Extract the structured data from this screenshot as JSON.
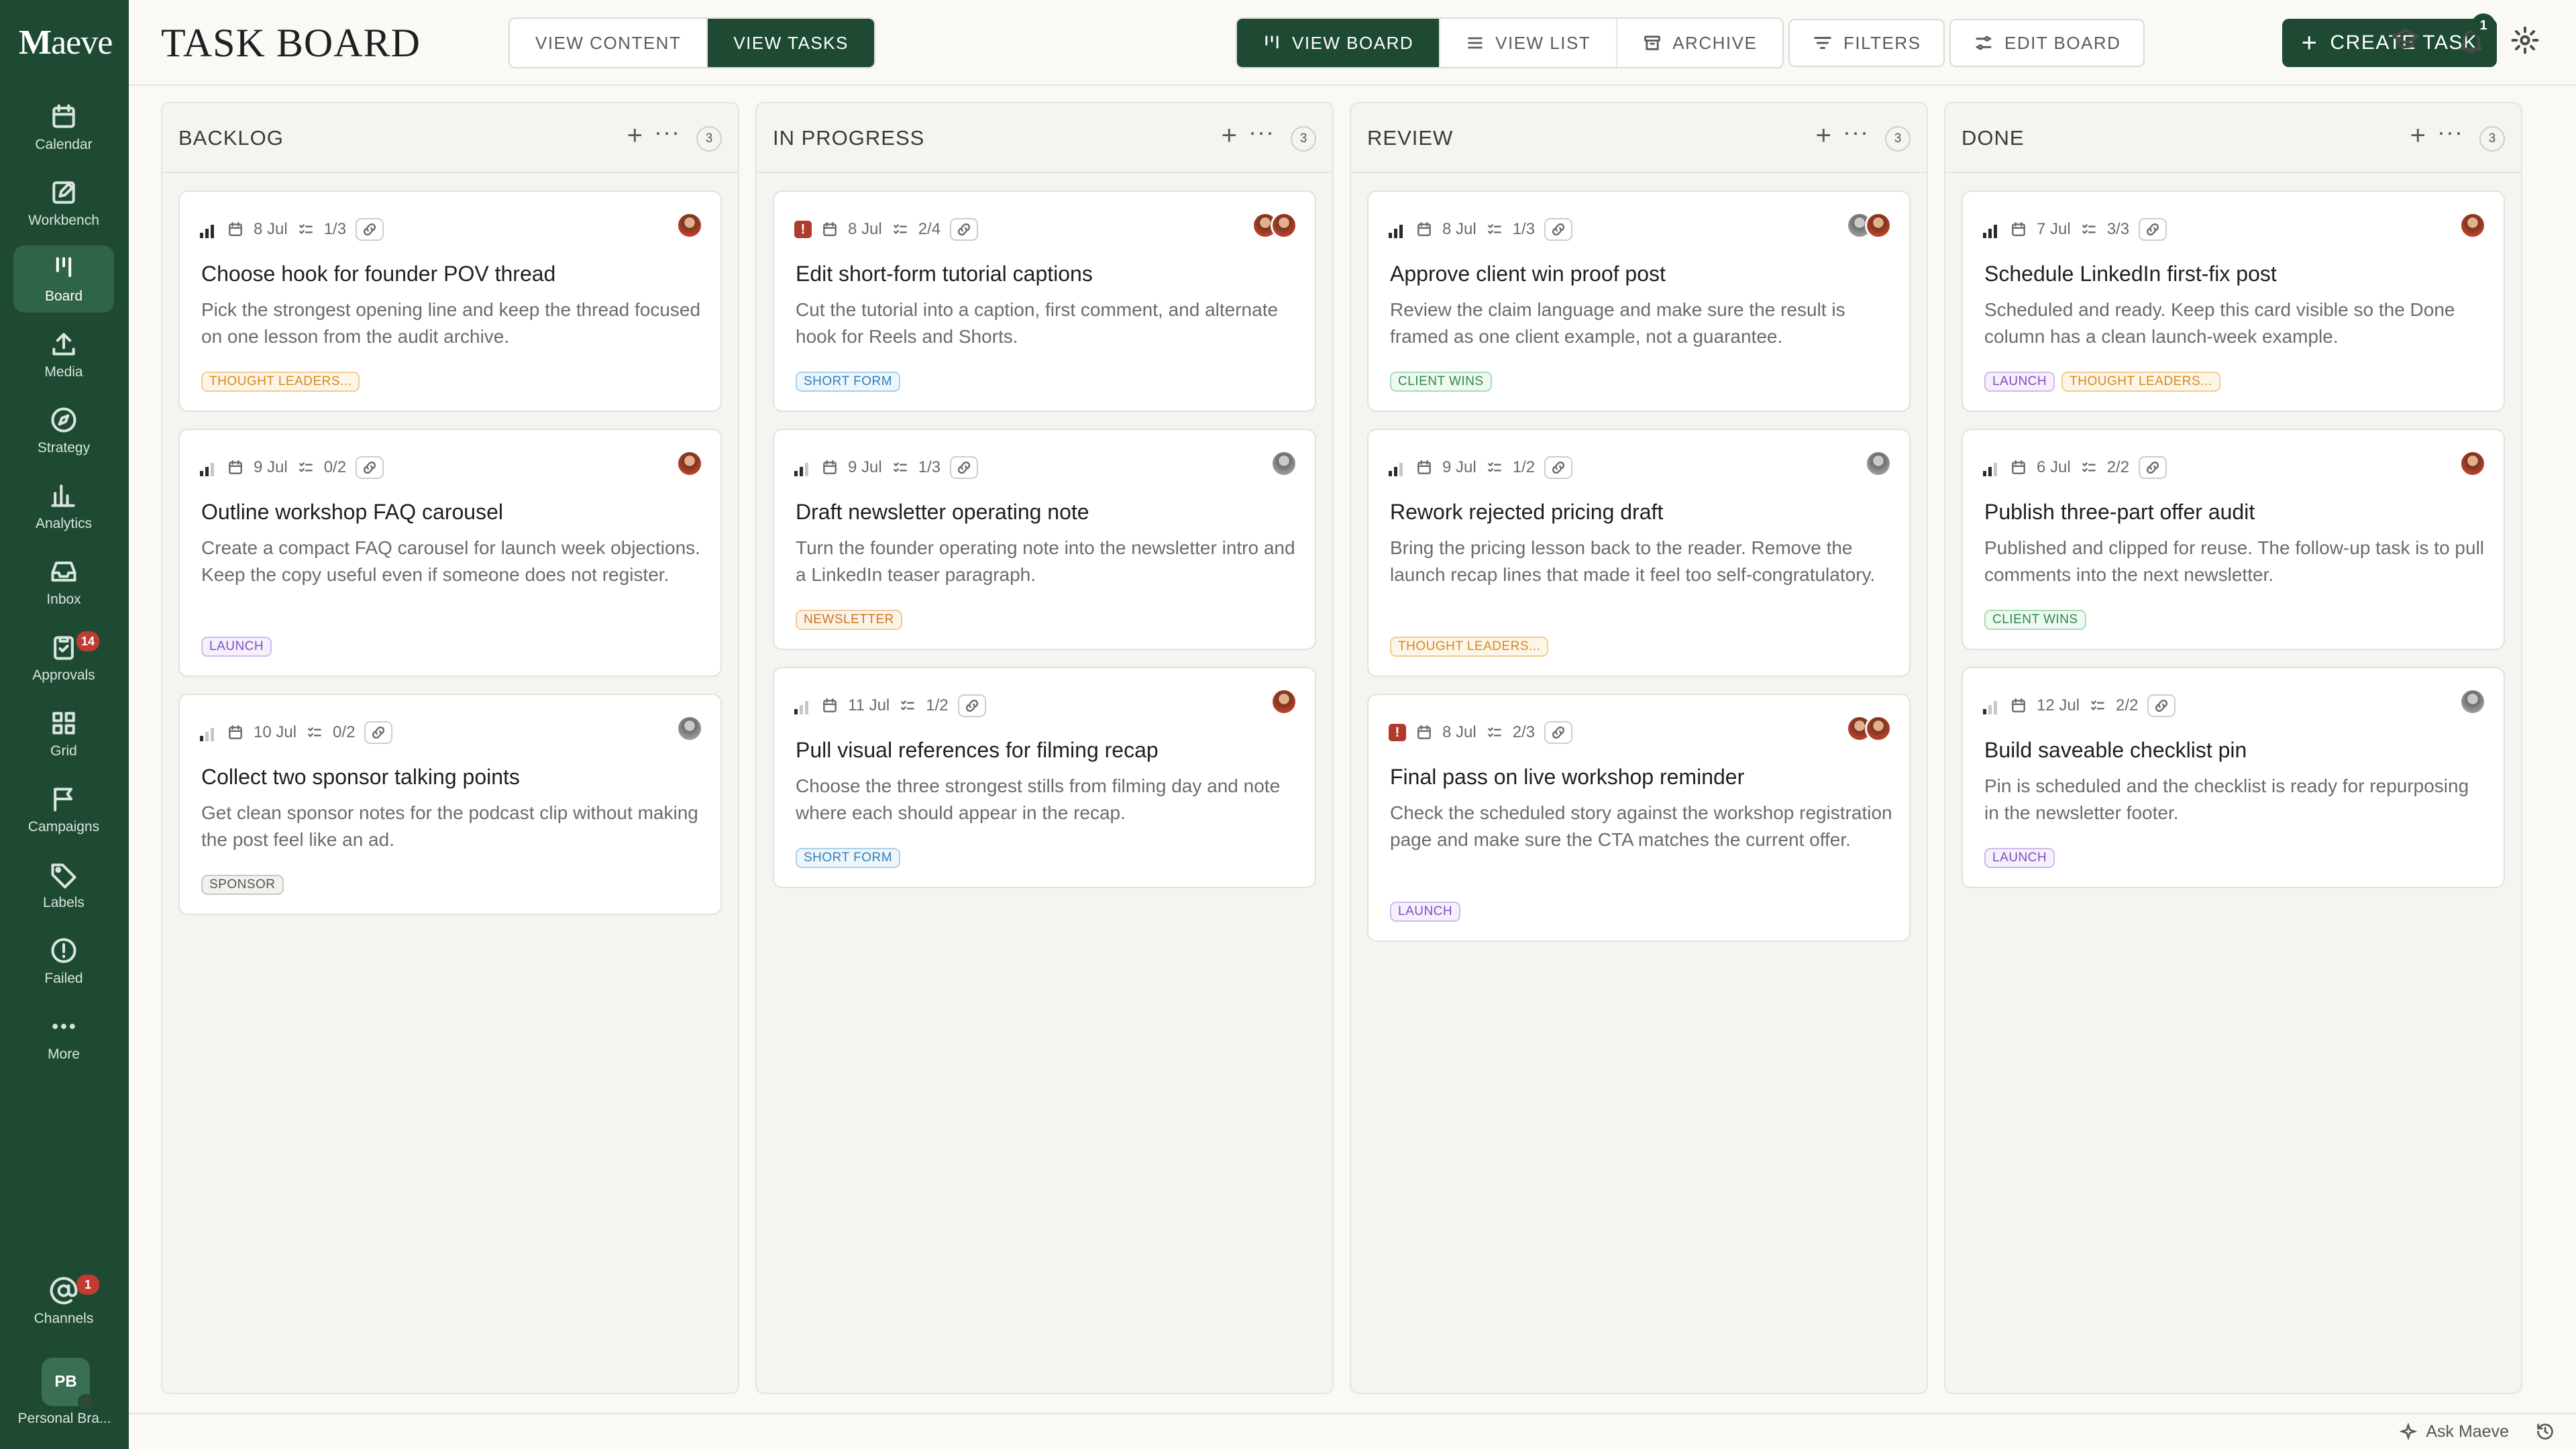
{
  "app": {
    "logo": "Maeve",
    "title": "TASK BOARD"
  },
  "header": {
    "view_toggle": [
      "VIEW CONTENT",
      "VIEW TASKS"
    ],
    "board_modes": [
      "VIEW BOARD",
      "VIEW LIST",
      "ARCHIVE"
    ],
    "filters": "FILTERS",
    "edit_board": "EDIT BOARD",
    "create_task": "CREATE TASK",
    "notifications_count": "1"
  },
  "sidebar": {
    "items": [
      {
        "label": "Calendar",
        "icon": "calendar-icon"
      },
      {
        "label": "Workbench",
        "icon": "edit-icon"
      },
      {
        "label": "Board",
        "icon": "board-icon",
        "active": true
      },
      {
        "label": "Media",
        "icon": "upload-icon"
      },
      {
        "label": "Strategy",
        "icon": "compass-icon"
      },
      {
        "label": "Analytics",
        "icon": "bar-chart-icon"
      },
      {
        "label": "Inbox",
        "icon": "inbox-icon"
      },
      {
        "label": "Approvals",
        "icon": "clipboard-check-icon",
        "badge": "14"
      },
      {
        "label": "Grid",
        "icon": "grid-icon"
      },
      {
        "label": "Campaigns",
        "icon": "flag-icon"
      },
      {
        "label": "Labels",
        "icon": "tag-icon"
      },
      {
        "label": "Failed",
        "icon": "alert-circle-icon"
      },
      {
        "label": "More",
        "icon": "more-icon"
      }
    ],
    "channels": {
      "label": "Channels",
      "badge": "1"
    },
    "profile": {
      "initials": "PB",
      "label": "Personal Bra..."
    }
  },
  "columns": [
    {
      "title": "BACKLOG",
      "count": "3",
      "cards": [
        {
          "priority": "high",
          "date": "8 Jul",
          "checklist": "1/3",
          "title": "Choose hook for founder POV thread",
          "desc": "Pick the strongest opening line and keep the thread focused on one lesson from the audit archive.",
          "tags": [
            {
              "label": "THOUGHT LEADERS...",
              "kind": "thought"
            }
          ],
          "avatars": [
            "r"
          ]
        },
        {
          "priority": "med",
          "date": "9 Jul",
          "checklist": "0/2",
          "title": "Outline workshop FAQ carousel",
          "desc": "Create a compact FAQ carousel for launch week objections. Keep the copy useful even if someone does not register.",
          "tags": [
            {
              "label": "LAUNCH",
              "kind": "launch"
            }
          ],
          "avatars": [
            "r"
          ]
        },
        {
          "priority": "low",
          "date": "10 Jul",
          "checklist": "0/2",
          "title": "Collect two sponsor talking points",
          "desc": "Get clean sponsor notes for the podcast clip without making the post feel like an ad.",
          "tags": [
            {
              "label": "SPONSOR",
              "kind": "sponsor"
            }
          ],
          "avatars": [
            "g"
          ]
        }
      ]
    },
    {
      "title": "IN PROGRESS",
      "count": "3",
      "cards": [
        {
          "priority": "urgent",
          "date": "8 Jul",
          "checklist": "2/4",
          "title": "Edit short-form tutorial captions",
          "desc": "Cut the tutorial into a caption, first comment, and alternate hook for Reels and Shorts.",
          "tags": [
            {
              "label": "SHORT FORM",
              "kind": "shortform"
            }
          ],
          "avatars": [
            "r",
            "r"
          ]
        },
        {
          "priority": "med",
          "date": "9 Jul",
          "checklist": "1/3",
          "title": "Draft newsletter operating note",
          "desc": "Turn the founder operating note into the newsletter intro and a LinkedIn teaser paragraph.",
          "tags": [
            {
              "label": "NEWSLETTER",
              "kind": "newsletter"
            }
          ],
          "avatars": [
            "g"
          ]
        },
        {
          "priority": "low",
          "date": "11 Jul",
          "checklist": "1/2",
          "title": "Pull visual references for filming recap",
          "desc": "Choose the three strongest stills from filming day and note where each should appear in the recap.",
          "tags": [
            {
              "label": "SHORT FORM",
              "kind": "shortform"
            }
          ],
          "avatars": [
            "r"
          ]
        }
      ]
    },
    {
      "title": "REVIEW",
      "count": "3",
      "cards": [
        {
          "priority": "high",
          "date": "8 Jul",
          "checklist": "1/3",
          "title": "Approve client win proof post",
          "desc": "Review the claim language and make sure the result is framed as one client example, not a guarantee.",
          "tags": [
            {
              "label": "CLIENT WINS",
              "kind": "clientwins"
            }
          ],
          "avatars": [
            "g",
            "r"
          ]
        },
        {
          "priority": "med",
          "date": "9 Jul",
          "checklist": "1/2",
          "title": "Rework rejected pricing draft",
          "desc": "Bring the pricing lesson back to the reader. Remove the launch recap lines that made it feel too self-congratulatory.",
          "tags": [
            {
              "label": "THOUGHT LEADERS...",
              "kind": "thought"
            }
          ],
          "avatars": [
            "g"
          ]
        },
        {
          "priority": "urgent",
          "date": "8 Jul",
          "checklist": "2/3",
          "title": "Final pass on live workshop reminder",
          "desc": "Check the scheduled story against the workshop registration page and make sure the CTA matches the current offer.",
          "tags": [
            {
              "label": "LAUNCH",
              "kind": "launch"
            }
          ],
          "avatars": [
            "r",
            "r"
          ]
        }
      ]
    },
    {
      "title": "DONE",
      "count": "3",
      "cards": [
        {
          "priority": "high",
          "date": "7 Jul",
          "checklist": "3/3",
          "title": "Schedule LinkedIn first-fix post",
          "desc": "Scheduled and ready. Keep this card visible so the Done column has a clean launch-week example.",
          "tags": [
            {
              "label": "LAUNCH",
              "kind": "launch"
            },
            {
              "label": "THOUGHT LEADERS...",
              "kind": "thought"
            }
          ],
          "avatars": [
            "r"
          ]
        },
        {
          "priority": "med",
          "date": "6 Jul",
          "checklist": "2/2",
          "title": "Publish three-part offer audit",
          "desc": "Published and clipped for reuse. The follow-up task is to pull comments into the next newsletter.",
          "tags": [
            {
              "label": "CLIENT WINS",
              "kind": "clientwins"
            }
          ],
          "avatars": [
            "r"
          ]
        },
        {
          "priority": "low",
          "date": "12 Jul",
          "checklist": "2/2",
          "title": "Build saveable checklist pin",
          "desc": "Pin is scheduled and the checklist is ready for repurposing in the newsletter footer.",
          "tags": [
            {
              "label": "LAUNCH",
              "kind": "launch"
            }
          ],
          "avatars": [
            "g"
          ]
        }
      ]
    }
  ],
  "footer": {
    "ask": "Ask Maeve"
  }
}
